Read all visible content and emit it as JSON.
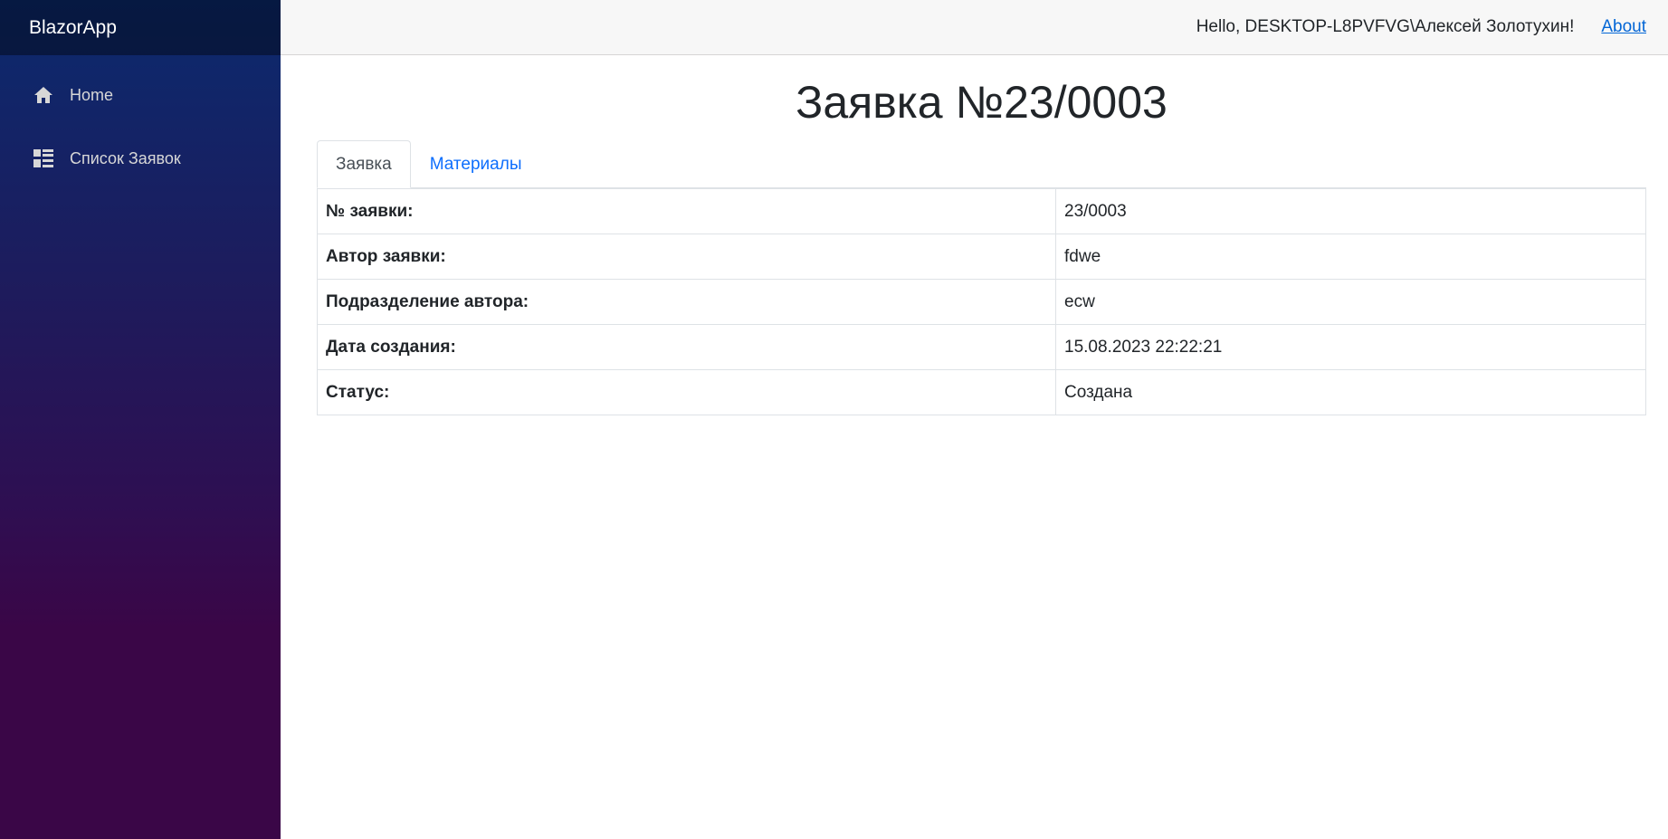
{
  "brand": "BlazorApp",
  "nav": [
    {
      "label": "Home",
      "icon": "home-icon"
    },
    {
      "label": "Список Заявок",
      "icon": "list-icon"
    }
  ],
  "top": {
    "greeting": "Hello, DESKTOP-L8PVFVG\\Алексей Золотухин!",
    "about": "About"
  },
  "page": {
    "title": "Заявка №23/0003"
  },
  "tabs": [
    {
      "label": "Заявка",
      "active": true
    },
    {
      "label": "Материалы",
      "active": false
    }
  ],
  "details": [
    {
      "label": "№ заявки:",
      "value": "23/0003"
    },
    {
      "label": "Автор заявки:",
      "value": "fdwe"
    },
    {
      "label": "Подразделение автора:",
      "value": "ecw"
    },
    {
      "label": "Дата создания:",
      "value": "15.08.2023 22:22:21"
    },
    {
      "label": "Статус:",
      "value": "Создана"
    }
  ],
  "colors": {
    "link": "#0366d6",
    "tab_link": "#0d6efd",
    "sidebar_top": "#0b2a6e",
    "sidebar_bottom": "#3a0647"
  }
}
